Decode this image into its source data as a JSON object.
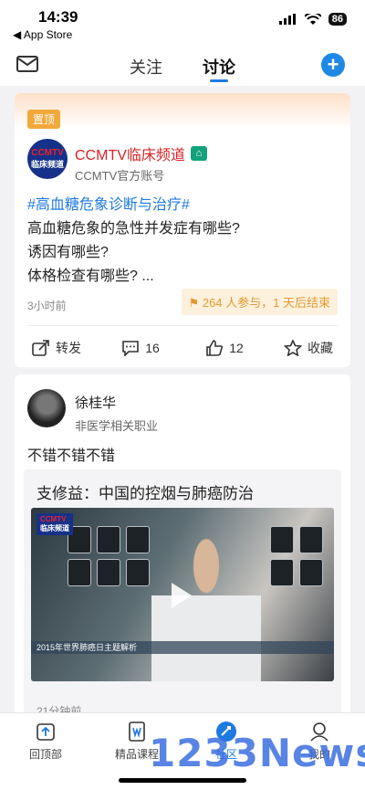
{
  "status_bar": {
    "time": "14:39",
    "back_label": "◀ App Store",
    "battery": "86"
  },
  "nav": {
    "tabs": [
      "关注",
      "讨论"
    ],
    "active_tab": "讨论"
  },
  "post1": {
    "pin_label": "置顶",
    "channel_name": "CCMTV临床频道",
    "channel_logo_lines": [
      "CCMTV",
      "临床频道"
    ],
    "account_type": "CCMTV官方账号",
    "topic": "#高血糖危象诊断与治疗#",
    "lines": [
      "高血糖危象的急性并发症有哪些?",
      "诱因有哪些?",
      "体格检查有哪些? ..."
    ],
    "time": "3小时前",
    "participation": "264 人参与，1 天后结束",
    "actions": {
      "share": "转发",
      "comments": "16",
      "likes": "12",
      "favorite": "收藏"
    }
  },
  "post2": {
    "user_name": "徐桂华",
    "user_job": "非医学相关职业",
    "comment": "不错不错不错",
    "shared_title": "支修益：中国的控烟与肺癌防治",
    "video_logo_lines": [
      "CCMTV",
      "临床频道"
    ],
    "video_caption": "2015年世界肺癌日主题解析",
    "time": "21分钟前"
  },
  "tabbar": {
    "items": [
      {
        "label": "回顶部",
        "icon": "arrow-up-icon"
      },
      {
        "label": "精品课程",
        "icon": "book-icon"
      },
      {
        "label": "社区",
        "icon": "community-icon"
      },
      {
        "label": "我的",
        "icon": "profile-icon"
      }
    ],
    "active": "社区"
  },
  "watermark": "1233News",
  "colors": {
    "accent": "#1f7ae0",
    "channel_red": "#d42323",
    "pin_orange": "#f2a93b"
  }
}
